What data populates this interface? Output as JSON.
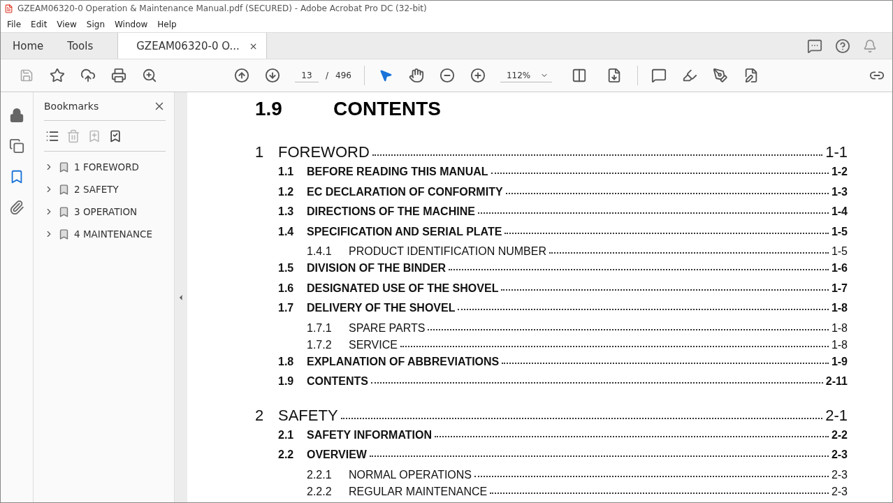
{
  "window": {
    "title": "GZEAM06320-0 Operation & Maintenance Manual.pdf (SECURED) - Adobe Acrobat Pro DC (32-bit)"
  },
  "menu": [
    "File",
    "Edit",
    "View",
    "Sign",
    "Window",
    "Help"
  ],
  "tabs": [
    {
      "label": "Home",
      "selected": false,
      "kind": "nav"
    },
    {
      "label": "Tools",
      "selected": false,
      "kind": "nav"
    },
    {
      "label": "GZEAM06320-0 O...",
      "selected": true,
      "kind": "doc",
      "close": "×"
    }
  ],
  "toolbar": {
    "page": "13",
    "separator": "/",
    "total": "496",
    "zoom": "112%"
  },
  "bookmarks": {
    "title": "Bookmarks",
    "items": [
      {
        "label": "1 FOREWORD",
        "expanded": false
      },
      {
        "label": "2 SAFETY",
        "expanded": false
      },
      {
        "label": "3 OPERATION",
        "expanded": false
      },
      {
        "label": "4 MAINTENANCE",
        "expanded": false
      }
    ]
  },
  "document": {
    "heading_number": "1.9",
    "heading": "CONTENTS",
    "entries": [
      {
        "kind": "chapter",
        "number": "1",
        "title": "FOREWORD",
        "page": "1-1"
      },
      {
        "kind": "section",
        "number": "1.1",
        "title": "BEFORE READING THIS MANUAL",
        "page": "1-2"
      },
      {
        "kind": "section",
        "number": "1.2",
        "title": "EC DECLARATION OF CONFORMITY",
        "page": "1-3"
      },
      {
        "kind": "section",
        "number": "1.3",
        "title": "DIRECTIONS OF THE MACHINE",
        "page": "1-4"
      },
      {
        "kind": "section",
        "number": "1.4",
        "title": "SPECIFICATION AND SERIAL PLATE",
        "page": "1-5"
      },
      {
        "kind": "subsection",
        "number": "1.4.1",
        "title": "PRODUCT IDENTIFICATION NUMBER",
        "page": "1-5"
      },
      {
        "kind": "section",
        "number": "1.5",
        "title": "DIVISION OF THE BINDER",
        "page": "1-6"
      },
      {
        "kind": "section",
        "number": "1.6",
        "title": "DESIGNATED USE OF THE SHOVEL",
        "page": "1-7"
      },
      {
        "kind": "section",
        "number": "1.7",
        "title": "DELIVERY OF THE SHOVEL",
        "page": "1-8"
      },
      {
        "kind": "subsection",
        "number": "1.7.1",
        "title": "SPARE PARTS",
        "page": "1-8"
      },
      {
        "kind": "subsection",
        "number": "1.7.2",
        "title": "SERVICE",
        "page": "1-8"
      },
      {
        "kind": "section",
        "number": "1.8",
        "title": "EXPLANATION OF ABBREVIATIONS",
        "page": "1-9"
      },
      {
        "kind": "section",
        "number": "1.9",
        "title": "CONTENTS",
        "page": "2-11"
      },
      {
        "kind": "chapter",
        "number": "2",
        "title": "SAFETY",
        "page": "2-1"
      },
      {
        "kind": "section",
        "number": "2.1",
        "title": "SAFETY INFORMATION",
        "page": "2-2"
      },
      {
        "kind": "section",
        "number": "2.2",
        "title": "OVERVIEW",
        "page": "2-3"
      },
      {
        "kind": "subsection",
        "number": "2.2.1",
        "title": "NORMAL OPERATIONS",
        "page": "2-3"
      },
      {
        "kind": "subsection",
        "number": "2.2.2",
        "title": "REGULAR MAINTENANCE",
        "page": "2-3"
      }
    ]
  }
}
